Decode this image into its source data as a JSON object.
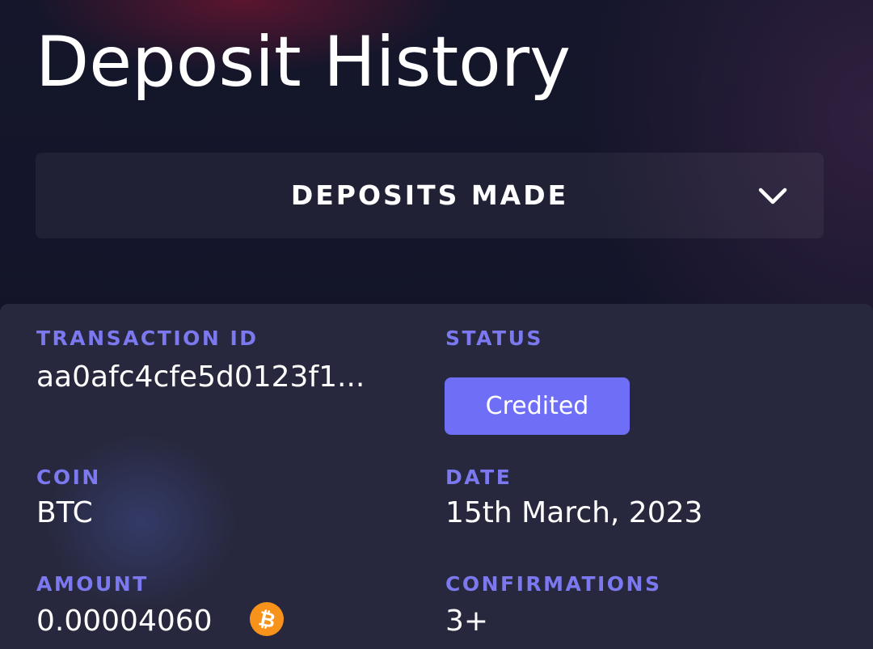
{
  "page": {
    "title": "Deposit History"
  },
  "filter": {
    "selected": "DEPOSITS MADE",
    "icon": "chevron-down-icon"
  },
  "deposit": {
    "transaction_id_label": "TRANSACTION ID",
    "transaction_id": "aa0afc4cfe5d0123f1...",
    "status_label": "STATUS",
    "status": "Credited",
    "coin_label": "COIN",
    "coin": "BTC",
    "date_label": "DATE",
    "date": "15th March, 2023",
    "amount_label": "AMOUNT",
    "amount": "0.00004060",
    "amount_icon": "bitcoin-icon",
    "confirmations_label": "CONFIRMATIONS",
    "confirmations": "3+"
  },
  "colors": {
    "background": "#13142a",
    "card": "#27283d",
    "label_accent": "#7b78f0",
    "status_badge": "#6e6ef7",
    "bitcoin": "#f7931a"
  }
}
